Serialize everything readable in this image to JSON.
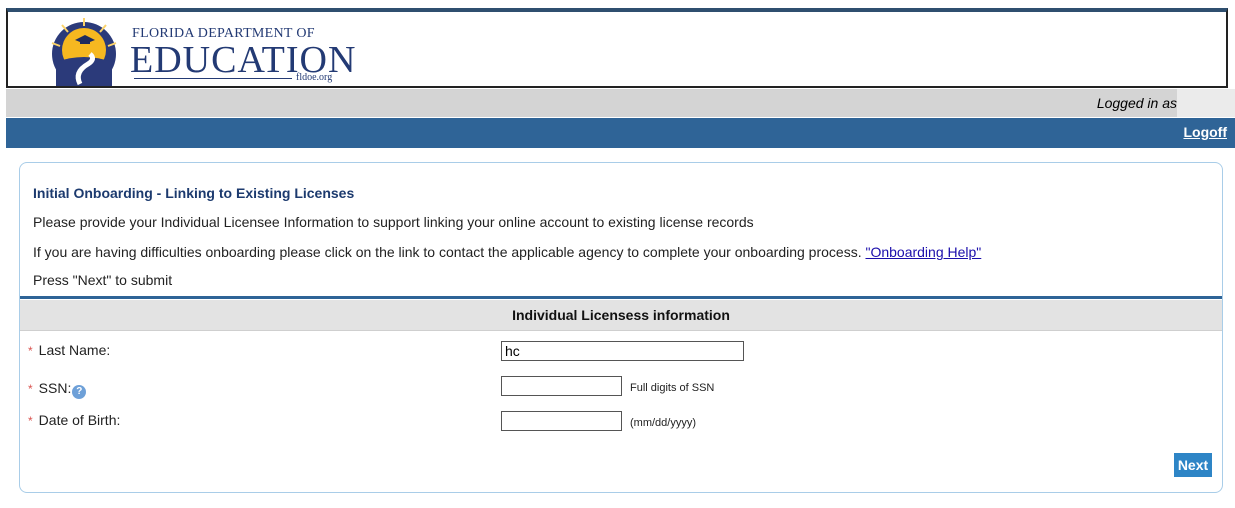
{
  "header": {
    "logo_title": "Florida Department of",
    "logo_edu": "EDUCATION",
    "logo_site": "fldoe.org"
  },
  "status": {
    "logged_in_text": "Logged in as"
  },
  "nav": {
    "logoff_label": "Logoff"
  },
  "panel": {
    "title": "Initial Onboarding - Linking to Existing Licenses",
    "line1": "Please provide your Individual Licensee Information to support linking your online account to existing license records",
    "line2": "If you are having difficulties onboarding please click on the link to contact the applicable agency to complete your onboarding process.",
    "help_link": "\"Onboarding Help\"",
    "line3": "Press \"Next\" to submit"
  },
  "form": {
    "section_title": "Individual Licensess information",
    "last_name_label": "Last Name:",
    "last_name_value": "hc",
    "ssn_label": "SSN:",
    "ssn_value": "",
    "ssn_hint": "Full digits of SSN",
    "dob_label": "Date of Birth:",
    "dob_value": "",
    "dob_hint": "(mm/dd/yyyy)",
    "next_label": "Next",
    "required_marker": "*"
  },
  "colors": {
    "nav_blue": "#2f6497",
    "button_blue": "#2e85c6",
    "status_gray": "#d4d4d4",
    "heading_navy": "#1c3a6e"
  }
}
